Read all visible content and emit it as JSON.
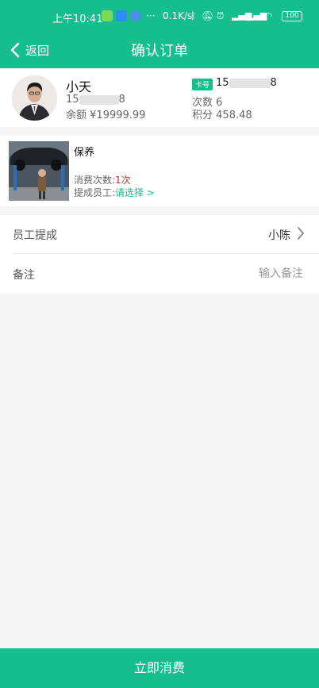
{
  "status_bar": {
    "time": "上午10:41",
    "dots": "···",
    "net_speed": "0.1K/s",
    "battery": "100",
    "icons": [
      "app-icon",
      "location-icon",
      "message-icon",
      "bluetooth-icon",
      "mute-icon",
      "alarm-icon",
      "signal-icon",
      "signal-icon",
      "wifi-icon",
      "battery-icon"
    ]
  },
  "nav": {
    "back_label": "返回",
    "title": "确认订单"
  },
  "member": {
    "name": "小天",
    "phone_prefix": "15",
    "phone_suffix": "8",
    "balance_label": "余额",
    "balance_value": "¥19999.99",
    "card_tag": "卡号",
    "card_prefix": "15",
    "card_suffix": "8",
    "times_label": "次数",
    "times_value": "6",
    "points_label": "积分",
    "points_value": "458.48"
  },
  "service": {
    "name": "保养",
    "count_label": "消费次数:",
    "count_value": "1次",
    "staff_label": "提成员工:",
    "staff_action": "请选择 >"
  },
  "form": {
    "commission_label": "员工提成",
    "commission_value": "小陈",
    "remark_label": "备注",
    "remark_placeholder": "输入备注"
  },
  "footer": {
    "submit_label": "立即消费"
  },
  "colors": {
    "accent": "#16bd8d",
    "highlight": "#d32f2f"
  }
}
